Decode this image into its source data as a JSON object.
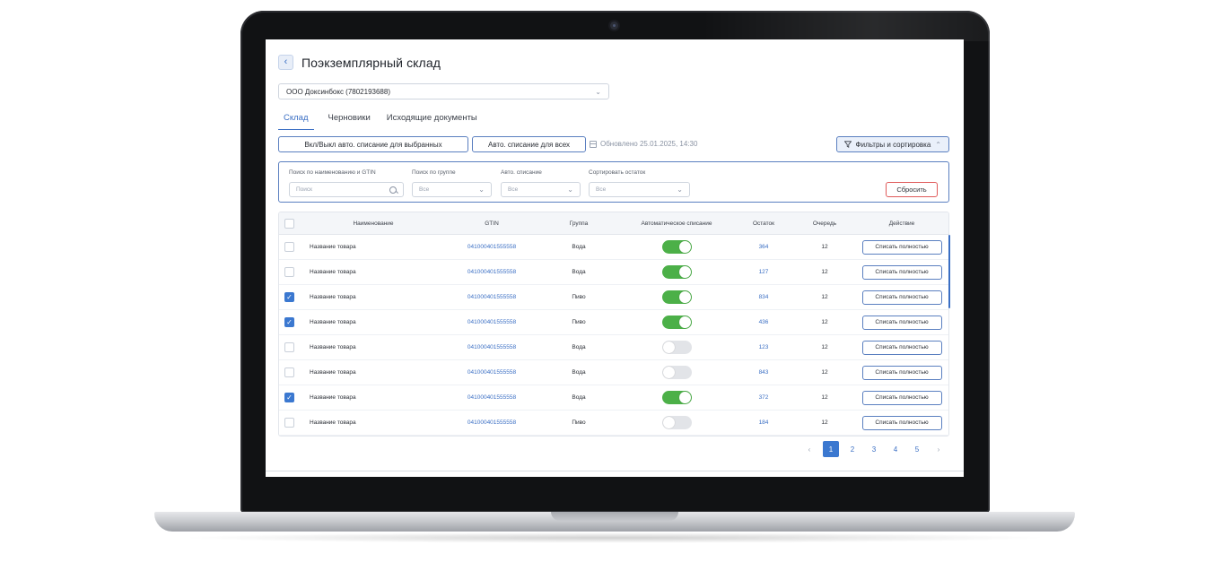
{
  "page": {
    "title": "Поэкземплярный склад",
    "back_icon": "chevron-left-icon"
  },
  "org_select": {
    "value": "ООО Доксинбокс (7802193688)"
  },
  "tabs": [
    {
      "label": "Склад",
      "active": true
    },
    {
      "label": "Черновики",
      "active": false
    },
    {
      "label": "Исходящие документы",
      "active": false
    }
  ],
  "toolbar": {
    "toggle_selected_label": "Вкл/Выкл авто. списание для выбранных",
    "auto_all_label": "Авто. списание для всех",
    "updated_text": "Обновлено 25.01.2025, 14:30",
    "filters_label": "Фильтры и сортировка"
  },
  "filters": {
    "search_label": "Поиск по наименованию и GTIN",
    "search_placeholder": "Поиск",
    "group_label": "Поиск по группе",
    "group_value": "Все",
    "auto_label": "Авто. списание",
    "auto_value": "Все",
    "sort_label": "Сортировать остаток",
    "sort_value": "Все",
    "reset_label": "Сбросить"
  },
  "table": {
    "headers": {
      "name": "Наименование",
      "gtin": "GTIN",
      "group": "Группа",
      "auto": "Автоматическое списание",
      "stock": "Остаток",
      "queue": "Очередь",
      "action": "Действие"
    },
    "rows": [
      {
        "checked": false,
        "name": "Название товара",
        "gtin": "041000401555558",
        "group": "Вода",
        "auto": true,
        "stock": "364",
        "queue": "12",
        "action": "Списать полностью"
      },
      {
        "checked": false,
        "name": "Название товара",
        "gtin": "041000401555558",
        "group": "Вода",
        "auto": true,
        "stock": "127",
        "queue": "12",
        "action": "Списать полностью"
      },
      {
        "checked": true,
        "name": "Название товара",
        "gtin": "041000401555558",
        "group": "Пиво",
        "auto": true,
        "stock": "834",
        "queue": "12",
        "action": "Списать полностью"
      },
      {
        "checked": true,
        "name": "Название товара",
        "gtin": "041000401555558",
        "group": "Пиво",
        "auto": true,
        "stock": "436",
        "queue": "12",
        "action": "Списать полностью"
      },
      {
        "checked": false,
        "name": "Название товара",
        "gtin": "041000401555558",
        "group": "Вода",
        "auto": false,
        "stock": "123",
        "queue": "12",
        "action": "Списать полностью"
      },
      {
        "checked": false,
        "name": "Название товара",
        "gtin": "041000401555558",
        "group": "Вода",
        "auto": false,
        "stock": "843",
        "queue": "12",
        "action": "Списать полностью"
      },
      {
        "checked": true,
        "name": "Название товара",
        "gtin": "041000401555558",
        "group": "Вода",
        "auto": true,
        "stock": "372",
        "queue": "12",
        "action": "Списать полностью"
      },
      {
        "checked": false,
        "name": "Название товара",
        "gtin": "041000401555558",
        "group": "Пиво",
        "auto": false,
        "stock": "184",
        "queue": "12",
        "action": "Списать полностью"
      }
    ]
  },
  "pagination": {
    "pages": [
      "1",
      "2",
      "3",
      "4",
      "5"
    ],
    "current": "1",
    "prev_icon": "chevron-left-icon",
    "next_icon": "chevron-right-icon"
  },
  "colors": {
    "accent": "#3b6fc4",
    "toggle_on": "#4cb048",
    "reset_border": "#e05a5a"
  }
}
